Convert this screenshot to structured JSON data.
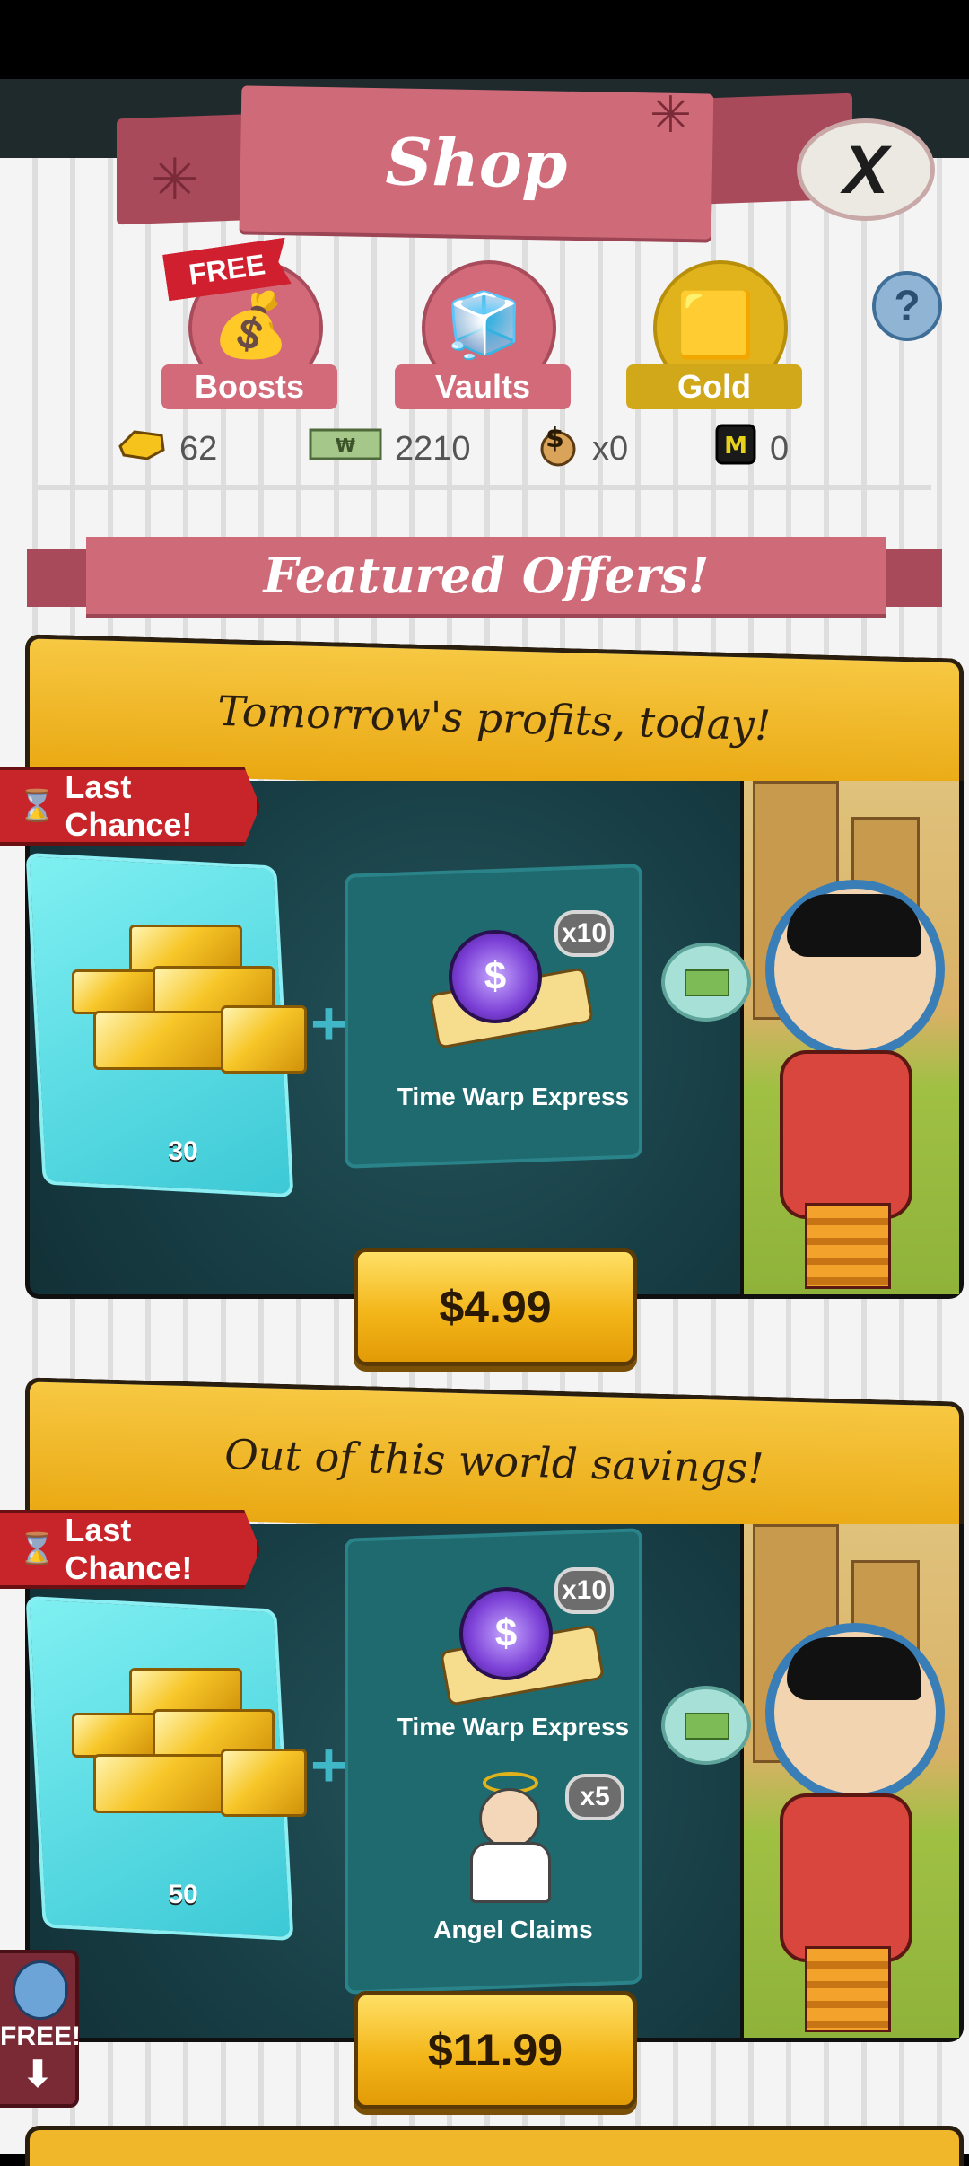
{
  "header": {
    "title": "Shop",
    "close_label": "X",
    "help_label": "?"
  },
  "tabs": [
    {
      "label": "Boosts",
      "badge": "FREE",
      "active": false
    },
    {
      "label": "Vaults",
      "active": false
    },
    {
      "label": "Gold",
      "active": true
    }
  ],
  "currencies": [
    {
      "icon": "gold-bar-icon",
      "value": "62"
    },
    {
      "icon": "cash-icon",
      "value": "2210"
    },
    {
      "icon": "money-bag-icon",
      "value": "x0"
    },
    {
      "icon": "mega-bucks-icon",
      "value": "0"
    }
  ],
  "featured": {
    "title": "Featured Offers!"
  },
  "offers": [
    {
      "title": "Tomorrow's profits, today!",
      "badge": "Last Chance!",
      "gold_amount": "30",
      "items": [
        {
          "name": "Time Warp Express",
          "multiplier": "x10",
          "icon": "stopwatch-icon"
        }
      ],
      "price": "$4.99"
    },
    {
      "title": "Out of this world savings!",
      "badge": "Last Chance!",
      "gold_amount": "50",
      "items": [
        {
          "name": "Time Warp Express",
          "multiplier": "x10",
          "icon": "stopwatch-icon"
        },
        {
          "name": "Angel Claims",
          "multiplier": "x5",
          "icon": "angel-icon"
        }
      ],
      "price": "$11.99"
    }
  ],
  "side_button": {
    "label": "FREE!",
    "arrow": "⬇"
  },
  "colors": {
    "pink": "#cf6a79",
    "gold": "#f3b61a",
    "teal": "#173c43",
    "cyan": "#3cc9d6"
  }
}
